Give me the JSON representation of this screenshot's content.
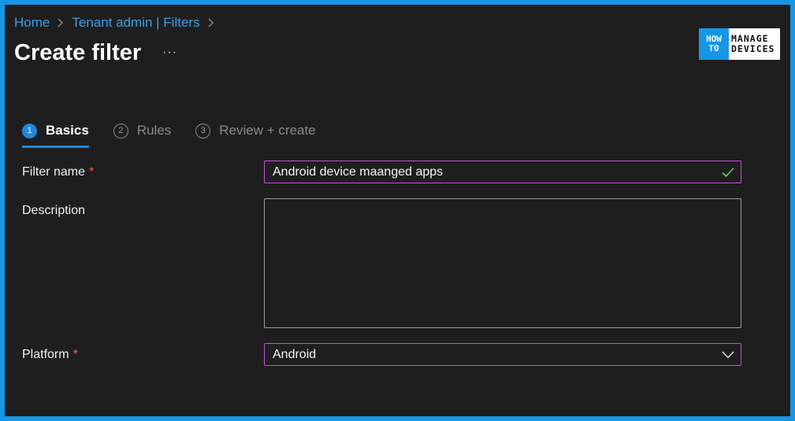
{
  "breadcrumb": {
    "items": [
      {
        "label": "Home"
      },
      {
        "label": "Tenant admin | Filters"
      }
    ]
  },
  "page": {
    "title": "Create filter",
    "more_label": "···"
  },
  "logo": {
    "how": "HOW",
    "to": "TO",
    "line1": "MANAGE",
    "line2": "DEVICES"
  },
  "steps": [
    {
      "number": "1",
      "label": "Basics",
      "state": "active"
    },
    {
      "number": "2",
      "label": "Rules",
      "state": "inactive"
    },
    {
      "number": "3",
      "label": "Review + create",
      "state": "inactive"
    }
  ],
  "form": {
    "filter_name": {
      "label": "Filter name",
      "required_mark": "*",
      "value": "Android device maanged apps",
      "valid_icon": "checkmark-icon"
    },
    "description": {
      "label": "Description",
      "value": ""
    },
    "platform": {
      "label": "Platform",
      "required_mark": "*",
      "value": "Android",
      "icon": "chevron-down-icon"
    }
  },
  "colors": {
    "accent": "#2288de",
    "link": "#3d9fe8",
    "focus_border": "#c94ce0",
    "valid": "#6ccf46",
    "required": "#ff5656",
    "frame_border": "#1597e5",
    "background": "#1f1e1e"
  }
}
